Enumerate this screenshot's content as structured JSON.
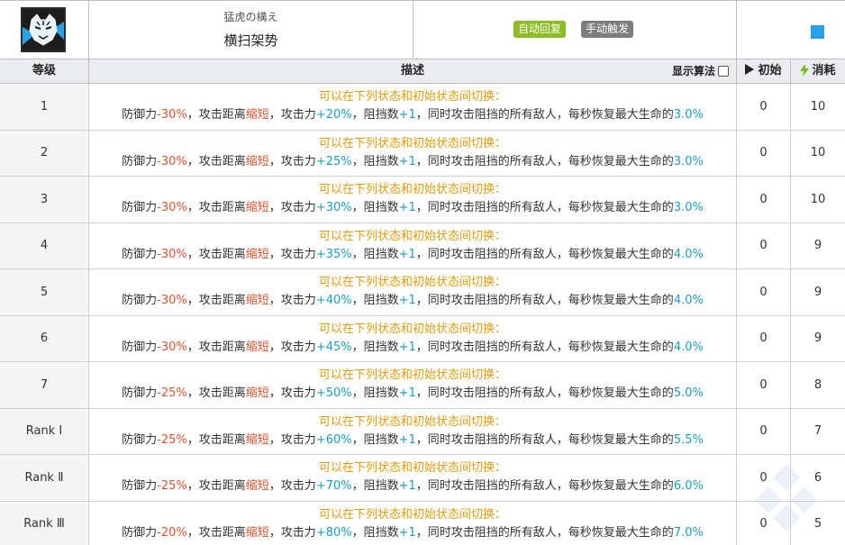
{
  "skill": {
    "subtitle": "猛虎の構え",
    "title": "横扫架势",
    "tags": {
      "auto": "自动回复",
      "manual": "手动触发"
    },
    "sp_color": "#2aa0e8"
  },
  "header": {
    "level": "等级",
    "description": "描述",
    "toggle_label": "显示算法",
    "initial": "初始",
    "cost": "消耗"
  },
  "colors": {
    "accent_orange": "#e39b09",
    "negative": "#e0522b",
    "positive": "#1a9dc9",
    "tag_auto": "#8cbd24",
    "tag_manual": "#7d7d7d"
  },
  "rows": [
    {
      "level": "1",
      "line1": "可以在下列状态和初始状态间切换：",
      "p1": "防御力",
      "def": "-30%",
      "p2": "，攻击距离",
      "range": "缩短",
      "p3": "，攻击力",
      "atk": "+20%",
      "p4": "，阻挡数",
      "block": "+1",
      "p5": "，同时攻击阻挡的所有敌人，每秒恢复最大生命的",
      "heal": "3.0%",
      "initial": "0",
      "cost": "10"
    },
    {
      "level": "2",
      "line1": "可以在下列状态和初始状态间切换：",
      "p1": "防御力",
      "def": "-30%",
      "p2": "，攻击距离",
      "range": "缩短",
      "p3": "，攻击力",
      "atk": "+25%",
      "p4": "，阻挡数",
      "block": "+1",
      "p5": "，同时攻击阻挡的所有敌人，每秒恢复最大生命的",
      "heal": "3.0%",
      "initial": "0",
      "cost": "10"
    },
    {
      "level": "3",
      "line1": "可以在下列状态和初始状态间切换：",
      "p1": "防御力",
      "def": "-30%",
      "p2": "，攻击距离",
      "range": "缩短",
      "p3": "，攻击力",
      "atk": "+30%",
      "p4": "，阻挡数",
      "block": "+1",
      "p5": "，同时攻击阻挡的所有敌人，每秒恢复最大生命的",
      "heal": "3.0%",
      "initial": "0",
      "cost": "10"
    },
    {
      "level": "4",
      "line1": "可以在下列状态和初始状态间切换：",
      "p1": "防御力",
      "def": "-30%",
      "p2": "，攻击距离",
      "range": "缩短",
      "p3": "，攻击力",
      "atk": "+35%",
      "p4": "，阻挡数",
      "block": "+1",
      "p5": "，同时攻击阻挡的所有敌人，每秒恢复最大生命的",
      "heal": "4.0%",
      "initial": "0",
      "cost": "9"
    },
    {
      "level": "5",
      "line1": "可以在下列状态和初始状态间切换：",
      "p1": "防御力",
      "def": "-30%",
      "p2": "，攻击距离",
      "range": "缩短",
      "p3": "，攻击力",
      "atk": "+40%",
      "p4": "，阻挡数",
      "block": "+1",
      "p5": "，同时攻击阻挡的所有敌人，每秒恢复最大生命的",
      "heal": "4.0%",
      "initial": "0",
      "cost": "9"
    },
    {
      "level": "6",
      "line1": "可以在下列状态和初始状态间切换：",
      "p1": "防御力",
      "def": "-30%",
      "p2": "，攻击距离",
      "range": "缩短",
      "p3": "，攻击力",
      "atk": "+45%",
      "p4": "，阻挡数",
      "block": "+1",
      "p5": "，同时攻击阻挡的所有敌人，每秒恢复最大生命的",
      "heal": "4.0%",
      "initial": "0",
      "cost": "9"
    },
    {
      "level": "7",
      "line1": "可以在下列状态和初始状态间切换：",
      "p1": "防御力",
      "def": "-25%",
      "p2": "，攻击距离",
      "range": "缩短",
      "p3": "，攻击力",
      "atk": "+50%",
      "p4": "，阻挡数",
      "block": "+1",
      "p5": "，同时攻击阻挡的所有敌人，每秒恢复最大生命的",
      "heal": "5.0%",
      "initial": "0",
      "cost": "8"
    },
    {
      "level": "Rank Ⅰ",
      "line1": "可以在下列状态和初始状态间切换：",
      "p1": "防御力",
      "def": "-25%",
      "p2": "，攻击距离",
      "range": "缩短",
      "p3": "，攻击力",
      "atk": "+60%",
      "p4": "，阻挡数",
      "block": "+1",
      "p5": "，同时攻击阻挡的所有敌人，每秒恢复最大生命的",
      "heal": "5.5%",
      "initial": "0",
      "cost": "7"
    },
    {
      "level": "Rank Ⅱ",
      "line1": "可以在下列状态和初始状态间切换：",
      "p1": "防御力",
      "def": "-25%",
      "p2": "，攻击距离",
      "range": "缩短",
      "p3": "，攻击力",
      "atk": "+70%",
      "p4": "，阻挡数",
      "block": "+1",
      "p5": "，同时攻击阻挡的所有敌人，每秒恢复最大生命的",
      "heal": "6.0%",
      "initial": "0",
      "cost": "6"
    },
    {
      "level": "Rank Ⅲ",
      "line1": "可以在下列状态和初始状态间切换：",
      "p1": "防御力",
      "def": "-20%",
      "p2": "，攻击距离",
      "range": "缩短",
      "p3": "，攻击力",
      "atk": "+80%",
      "p4": "，阻挡数",
      "block": "+1",
      "p5": "，同时攻击阻挡的所有敌人，每秒恢复最大生命的",
      "heal": "7.0%",
      "initial": "0",
      "cost": "5"
    }
  ]
}
